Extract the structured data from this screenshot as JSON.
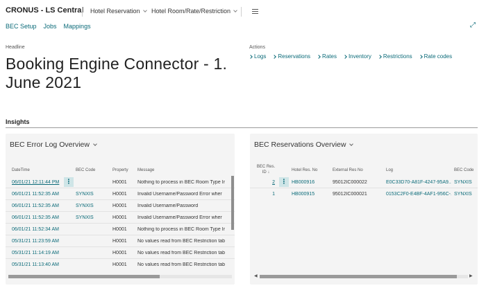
{
  "topbar": {
    "company": "CRONUS - LS Central",
    "nav": [
      "Hotel Reservation",
      "Hotel Room/Rate/Restriction"
    ]
  },
  "subnav": [
    "BEC Setup",
    "Jobs",
    "Mappings"
  ],
  "headline": {
    "label": "Headline",
    "title": "Booking Engine Connector - 1. June 2021"
  },
  "actions": {
    "label": "Actions",
    "items": [
      "Logs",
      "Reservations",
      "Rates",
      "Inventory",
      "Restrictions",
      "Rate codes"
    ]
  },
  "insights": {
    "label": "Insights"
  },
  "error_log": {
    "title": "BEC Error Log Overview",
    "columns": [
      "DateTime",
      "BEC Code",
      "Property",
      "Message"
    ],
    "rows": [
      {
        "datetime": "06/01/21 12:11:44 PM",
        "bec_code": "",
        "property": "H0001",
        "message": "Nothing to process in BEC Room Type Ir"
      },
      {
        "datetime": "06/01/21 11:52:35 AM",
        "bec_code": "SYNXIS",
        "property": "H0001",
        "message": "Invalid Username/Password   Error wher"
      },
      {
        "datetime": "06/01/21 11:52:35 AM",
        "bec_code": "SYNXIS",
        "property": "H0001",
        "message": "Invalid Username/Password"
      },
      {
        "datetime": "06/01/21 11:52:35 AM",
        "bec_code": "SYNXIS",
        "property": "H0001",
        "message": "Invalid Username/Password   Error wher"
      },
      {
        "datetime": "06/01/21 11:52:34 AM",
        "bec_code": "",
        "property": "H0001",
        "message": "Nothing to process in BEC Room Type Ir"
      },
      {
        "datetime": "05/31/21 11:23:59 AM",
        "bec_code": "",
        "property": "H0001",
        "message": "No values read from BEC Restriction tab"
      },
      {
        "datetime": "05/31/21 11:14:19 AM",
        "bec_code": "",
        "property": "H0001",
        "message": "No values read from BEC Restriction tab"
      },
      {
        "datetime": "05/31/21 11:13:40 AM",
        "bec_code": "",
        "property": "H0001",
        "message": "No values read from BEC Restriction tab"
      }
    ]
  },
  "reservations": {
    "title": "BEC Reservations Overview",
    "columns": [
      "BEC Res. ID ↓",
      "Hotel Res. No",
      "External Res No",
      "Log",
      "BEC Code"
    ],
    "rows": [
      {
        "id": "2",
        "hotel_res": "HB000916",
        "external_res": "95012IC000022",
        "log": "E0C33D70-A81F-4247-95A9...",
        "bec_code": "SYNXIS"
      },
      {
        "id": "1",
        "hotel_res": "HB000915",
        "external_res": "95012IC000021",
        "log": "0153C2F0-E4BF-4AF1-956C-...",
        "bec_code": "SYNXIS"
      }
    ]
  },
  "colors": {
    "accent": "#0a6a78",
    "panel": "#f4f4f4"
  },
  "icons": [
    "chevron-down-icon",
    "hamburger-menu-icon",
    "expand-icon",
    "chevron-right-icon",
    "more-options-icon"
  ]
}
